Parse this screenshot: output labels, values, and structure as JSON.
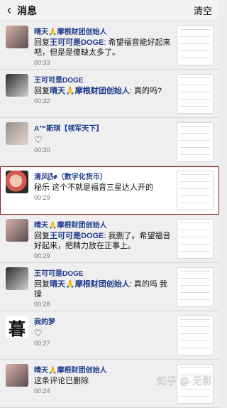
{
  "header": {
    "title": "消息",
    "clear_label": "清空"
  },
  "messages": [
    {
      "name": "晴天🙏摩根财团创始人",
      "reply_label": "回复",
      "reply_to": "王可可是DOGE",
      "text": ": 希望福音能好起来吧，但是是傻缺太多了。",
      "time": "00:33",
      "avatar_icon": "avatar"
    },
    {
      "name": "王可可是DOGE",
      "reply_label": "回复",
      "reply_to": "晴天🙏摩根财团创始人",
      "text": ": 真的吗?",
      "time": "00:32",
      "avatar_icon": "avatar"
    },
    {
      "name": "A™斯琪【领军天下】",
      "reaction": "♡",
      "time": "00:30",
      "avatar_icon": "avatar"
    },
    {
      "name": "清风🌬（数字化货币）",
      "text": "秘乐 这个不就是福音三星达人开的",
      "time": "00:29",
      "avatar_icon": "avatar"
    },
    {
      "name": "晴天🙏摩根财团创始人",
      "reply_label": "回复",
      "reply_to": "王可可是DOGE",
      "text": ": 我删了。希望福音好起来，把精力放在正事上。",
      "time": "00:29",
      "avatar_icon": "avatar"
    },
    {
      "name": "王可可是DOGE",
      "reply_label": "回复",
      "reply_to": "晴天🙏摩根财团创始人",
      "text": ": 真的吗 我操",
      "time": "00:28",
      "avatar_icon": "avatar"
    },
    {
      "name": "我的梦",
      "reaction": "♡",
      "time": "00:27",
      "avatar_icon": "avatar",
      "avatar_glyph": "暮"
    },
    {
      "name": "晴天🙏摩根财团创始人",
      "text": "这条评论已删除",
      "time": "00:24",
      "avatar_icon": "avatar"
    }
  ],
  "watermark": {
    "text": "知乎 @ 无影"
  }
}
